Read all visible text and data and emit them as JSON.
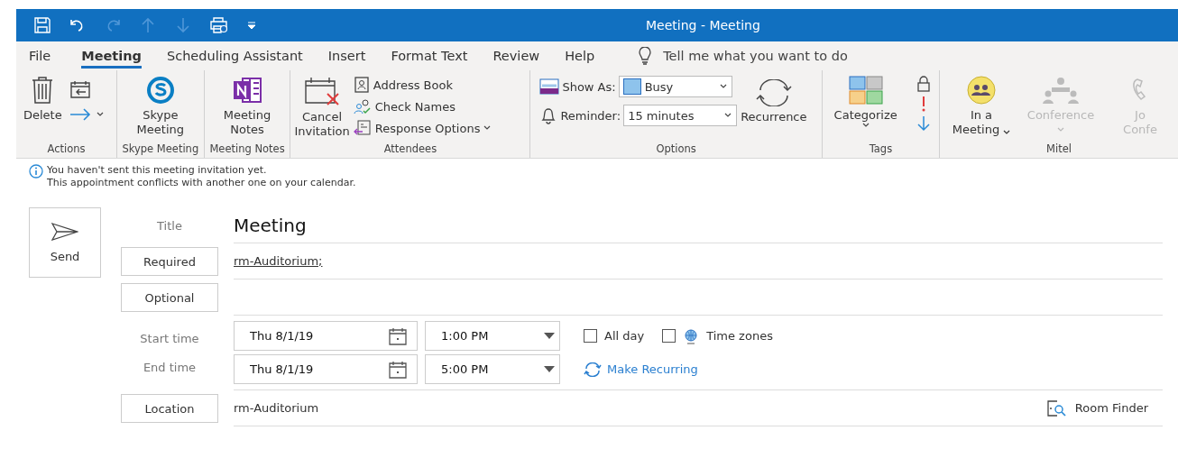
{
  "window": {
    "title": "Meeting  -  Meeting"
  },
  "quick_access": [
    {
      "kind": "save",
      "disabled": false
    },
    {
      "kind": "undo",
      "disabled": false
    },
    {
      "kind": "redo",
      "disabled": true
    },
    {
      "kind": "up",
      "disabled": true
    },
    {
      "kind": "down",
      "disabled": true
    },
    {
      "kind": "print",
      "disabled": false
    },
    {
      "kind": "customize",
      "disabled": false
    }
  ],
  "tabs": [
    {
      "label": "File",
      "selected": false
    },
    {
      "label": "Meeting",
      "selected": true
    },
    {
      "label": "Scheduling Assistant",
      "selected": false
    },
    {
      "label": "Insert",
      "selected": false
    },
    {
      "label": "Format Text",
      "selected": false
    },
    {
      "label": "Review",
      "selected": false
    },
    {
      "label": "Help",
      "selected": false
    }
  ],
  "tell_me": "Tell me what you want to do",
  "ribbon": {
    "actions": {
      "label": "Actions",
      "delete": "Delete"
    },
    "skype": {
      "label": "Skype Meeting",
      "button": [
        "Skype",
        "Meeting"
      ]
    },
    "notes": {
      "label": "Meeting Notes",
      "button": [
        "Meeting",
        "Notes"
      ]
    },
    "attendees": {
      "label": "Attendees",
      "cancel": [
        "Cancel",
        "Invitation"
      ],
      "address_book": "Address Book",
      "check_names": "Check Names",
      "response_options": "Response Options"
    },
    "options": {
      "label": "Options",
      "show_as_label": "Show As:",
      "show_as": "Busy",
      "reminder_label": "Reminder:",
      "reminder": "15 minutes",
      "recurrence": "Recurrence"
    },
    "tags": {
      "label": "Tags",
      "categorize": "Categorize"
    },
    "mitel": {
      "label": "Mitel",
      "buttons": [
        {
          "lines": [
            "In a",
            "Meeting"
          ],
          "disabled": false,
          "kind": "meeting",
          "dropdown": true
        },
        {
          "lines": [
            "Conference"
          ],
          "disabled": true,
          "kind": "conference",
          "dropdown": true
        },
        {
          "lines": [
            "Jo",
            "Confe"
          ],
          "disabled": true,
          "kind": "join",
          "dropdown": false
        }
      ]
    }
  },
  "infobar": [
    "You haven't sent this meeting invitation yet.",
    "This appointment conflicts with another one on your calendar."
  ],
  "send": "Send",
  "form": {
    "title_label": "Title",
    "title": "Meeting",
    "required_button": "Required",
    "required": "rm-Auditorium;",
    "optional_button": "Optional",
    "start_label": "Start time",
    "start_date": "Thu 8/1/19",
    "start_time": "1:00 PM",
    "end_label": "End time",
    "end_date": "Thu 8/1/19",
    "end_time": "5:00 PM",
    "all_day": {
      "label": "All day",
      "checked": false
    },
    "time_zones": {
      "label": "Time zones",
      "checked": false
    },
    "make_recurring": "Make Recurring",
    "location_button": "Location",
    "location": "rm-Auditorium",
    "room_finder": "Room Finder"
  }
}
